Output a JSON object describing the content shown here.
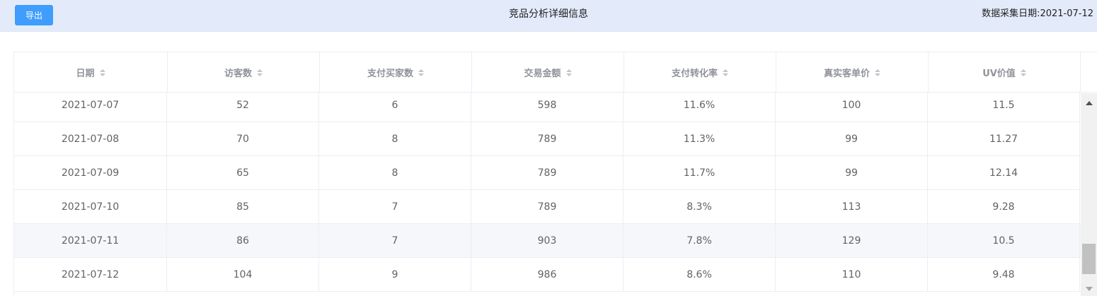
{
  "toolbar": {
    "export_label": "导出"
  },
  "page": {
    "title": "竞品分析详细信息",
    "collect_date_label": "数据采集日期:2021-07-12"
  },
  "table": {
    "columns": [
      "日期",
      "访客数",
      "支付买家数",
      "交易金额",
      "支付转化率",
      "真实客单价",
      "UV价值"
    ],
    "rows": [
      [
        "2021-07-07",
        "52",
        "6",
        "598",
        "11.6%",
        "100",
        "11.5"
      ],
      [
        "2021-07-08",
        "70",
        "8",
        "789",
        "11.3%",
        "99",
        "11.27"
      ],
      [
        "2021-07-09",
        "65",
        "8",
        "789",
        "11.7%",
        "99",
        "12.14"
      ],
      [
        "2021-07-10",
        "85",
        "7",
        "789",
        "8.3%",
        "113",
        "9.28"
      ],
      [
        "2021-07-11",
        "86",
        "7",
        "903",
        "7.8%",
        "129",
        "10.5"
      ],
      [
        "2021-07-12",
        "104",
        "9",
        "986",
        "8.6%",
        "110",
        "9.48"
      ]
    ],
    "highlighted_row": 4
  },
  "icons": {
    "sort": "sort-caret-icon",
    "scroll_up": "scroll-up-arrow-icon",
    "scroll_down": "scroll-down-arrow-icon"
  },
  "colors": {
    "accent": "#3f9dfd",
    "header_bar": "#e3ebfb",
    "row_highlight": "#f5f7fa"
  }
}
